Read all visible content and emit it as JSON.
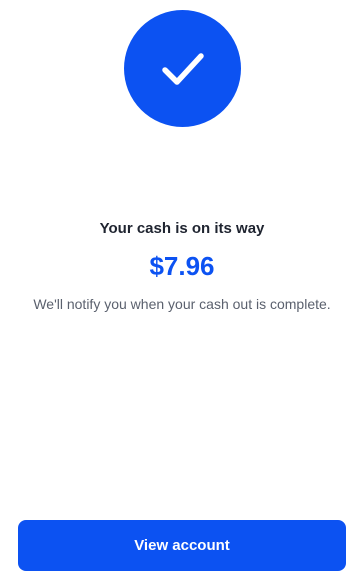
{
  "success": {
    "icon": "checkmark-icon",
    "title": "Your cash is on its way",
    "amount": "$7.96",
    "message": "We'll notify you when your cash out is complete."
  },
  "actions": {
    "view_account_label": "View account"
  },
  "colors": {
    "accent": "#0c52f2",
    "headline": "#1f2430",
    "message": "#5b616e",
    "background": "#ffffff"
  }
}
